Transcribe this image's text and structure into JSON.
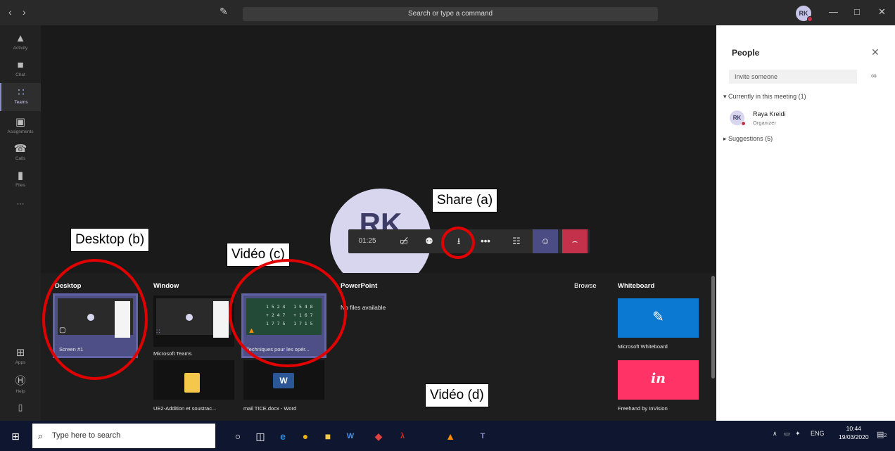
{
  "titlebar": {
    "back_icon": "chevron-left-icon",
    "forward_icon": "chevron-right-icon",
    "search_placeholder": "Search or type a command",
    "avatar_initials": "RK"
  },
  "rail": {
    "items": [
      {
        "label": "Activity",
        "icon": "bell-icon"
      },
      {
        "label": "Chat",
        "icon": "chat-icon"
      },
      {
        "label": "Teams",
        "icon": "teams-icon"
      },
      {
        "label": "Assignments",
        "icon": "assignments-icon"
      },
      {
        "label": "Calls",
        "icon": "phone-icon"
      },
      {
        "label": "Files",
        "icon": "files-icon"
      },
      {
        "label": "Apps",
        "icon": "apps-icon"
      },
      {
        "label": "Help",
        "icon": "help-icon"
      }
    ],
    "more": "···"
  },
  "meeting": {
    "avatar_initials": "RK",
    "timer": "01:25"
  },
  "share_tray": {
    "desktop": {
      "header": "Desktop",
      "items": [
        {
          "label": "Screen #1"
        }
      ]
    },
    "window": {
      "header": "Window",
      "items": [
        {
          "label": "Microsoft Teams"
        },
        {
          "label": "Techniques pour les opér..."
        },
        {
          "label": "UE2-Addition et soustrac..."
        },
        {
          "label": "mail TICE.docx - Word"
        }
      ]
    },
    "powerpoint": {
      "header": "PowerPoint",
      "empty": "No files available"
    },
    "browse": "Browse",
    "whiteboard": {
      "header": "Whiteboard",
      "items": [
        {
          "label": "Microsoft Whiteboard"
        },
        {
          "label": "Freehand by InVision",
          "mark": "in"
        }
      ]
    }
  },
  "people_pane": {
    "title": "People",
    "invite_placeholder": "Invite someone",
    "current_section": "Currently in this meeting (1)",
    "participant": {
      "initials": "RK",
      "name": "Raya Kreidi",
      "role": "Organizer"
    },
    "suggestions_section": "Suggestions (5)"
  },
  "annotations": {
    "share": "Share (a)",
    "desktop": "Desktop (b)",
    "video_c": "Vidéo (c)",
    "video_d": "Vidéo (d)"
  },
  "taskbar": {
    "search_placeholder": "Type here to search",
    "language": "ENG",
    "time": "10:44",
    "date": "19/03/2020",
    "notification_count": "2"
  },
  "colors": {
    "accent": "#6264a7",
    "hangup": "#c4314b",
    "annotation_ring": "#e10000",
    "whiteboard_ms": "#0b78d1",
    "whiteboard_invision": "#ff3366"
  }
}
